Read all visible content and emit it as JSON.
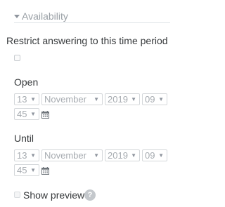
{
  "section": {
    "legend": "Availability"
  },
  "restrict": {
    "label": "Restrict answering to this time period",
    "checked": false
  },
  "open": {
    "label": "Open",
    "day": "13",
    "month": "November",
    "year": "2019",
    "hour": "09",
    "minute": "45"
  },
  "until": {
    "label": "Until",
    "day": "13",
    "month": "November",
    "year": "2019",
    "hour": "09",
    "minute": "45"
  },
  "preview": {
    "label": "Show preview",
    "help": "?",
    "checked": false
  },
  "icons": {
    "collapse": "caret-down-icon",
    "calendar": "calendar-icon",
    "dropdown": "chevron-down-icon",
    "help": "question-circle-icon"
  }
}
